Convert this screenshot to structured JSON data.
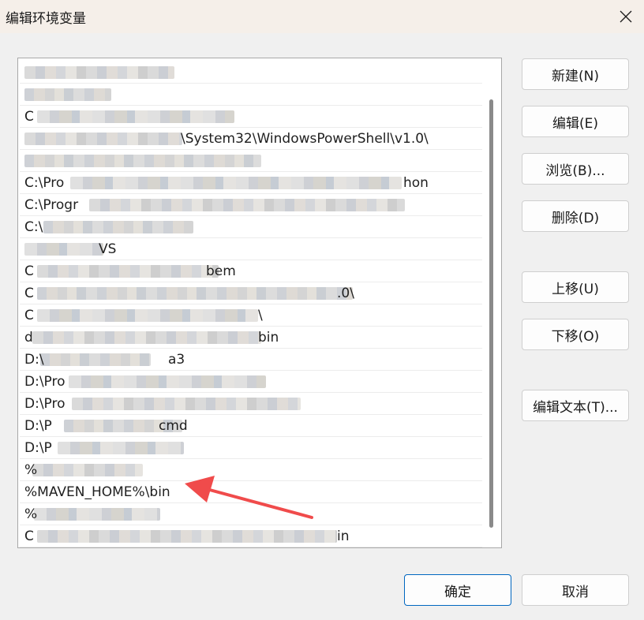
{
  "window": {
    "title": "编辑环境变量"
  },
  "path_list": {
    "rows": [
      {
        "pre": "",
        "suf": ""
      },
      {
        "pre": "",
        "suf": ""
      },
      {
        "pre": "C",
        "suf": ""
      },
      {
        "pre": "",
        "suf": "\\System32\\WindowsPowerShell\\v1.0\\"
      },
      {
        "pre": "",
        "suf": ""
      },
      {
        "pre": "C:\\Pro",
        "suf": "hon"
      },
      {
        "pre": "C:\\Progr",
        "suf": ""
      },
      {
        "pre": "C:\\",
        "suf": ""
      },
      {
        "pre": "",
        "suf": "VS"
      },
      {
        "pre": "C",
        "suf": "bem"
      },
      {
        "pre": "C",
        "suf": ".0\\"
      },
      {
        "pre": "C",
        "suf": "\\"
      },
      {
        "pre": "d",
        "suf": "bin"
      },
      {
        "pre": "D:\\",
        "suf": "a3"
      },
      {
        "pre": "D:\\Pro",
        "suf": ""
      },
      {
        "pre": "D:\\Pro",
        "suf": ""
      },
      {
        "pre": "D:\\P",
        "suf": "cmd"
      },
      {
        "pre": "D:\\P",
        "suf": ""
      },
      {
        "pre": "%",
        "suf": ""
      },
      {
        "pre": "%MAVEN_HOME%\\bin",
        "suf": ""
      },
      {
        "pre": "%",
        "suf": ""
      },
      {
        "pre": "C",
        "suf": "in"
      }
    ]
  },
  "buttons": {
    "new": "新建(N)",
    "edit": "编辑(E)",
    "browse": "浏览(B)...",
    "delete": "删除(D)",
    "move_up": "上移(U)",
    "move_down": "下移(O)",
    "edit_text": "编辑文本(T)...",
    "ok": "确定",
    "cancel": "取消"
  },
  "colors": {
    "accent": "#0067c0",
    "annotation_arrow": "#f04b4b"
  }
}
